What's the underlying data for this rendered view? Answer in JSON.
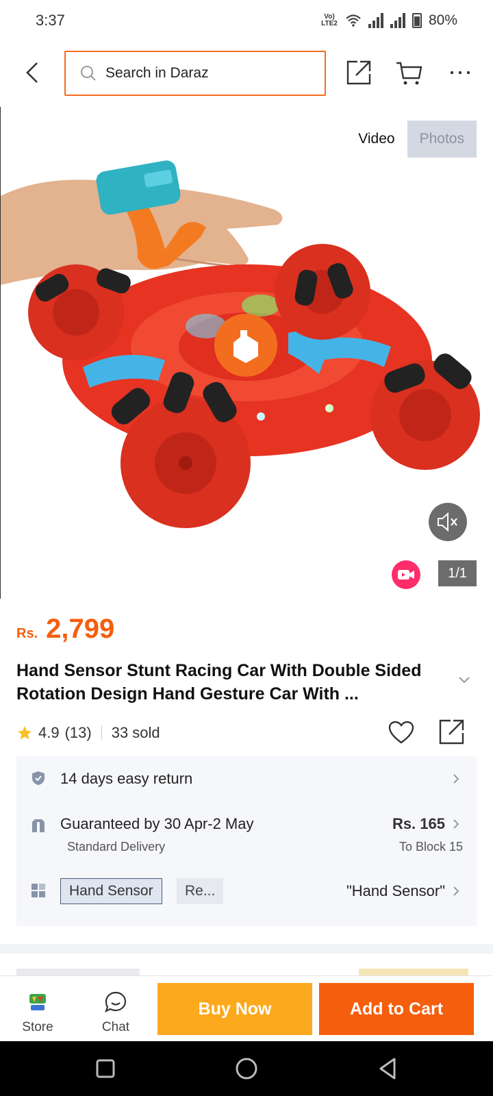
{
  "status_bar": {
    "time": "3:37",
    "network": "Vo) LTE2",
    "battery": "80%"
  },
  "header": {
    "search_placeholder": "Search in Daraz"
  },
  "gallery": {
    "tabs": [
      {
        "label": "Video",
        "selected": false
      },
      {
        "label": "Photos",
        "selected": true
      }
    ],
    "counter": "1/1"
  },
  "product": {
    "currency": "Rs.",
    "price": "2,799",
    "title": "Hand Sensor Stunt Racing Car With Double Sided Rotation Design Hand Gesture Car With ...",
    "rating": "4.9",
    "reviews": "(13)",
    "sold": "33 sold"
  },
  "info": {
    "return_text": "14 days easy return",
    "delivery_text": "Guaranteed by 30 Apr-2 May",
    "delivery_type": "Standard Delivery",
    "delivery_fee": "Rs. 165",
    "delivery_location": "To Block 15",
    "variants": [
      "Hand Sensor",
      "Re..."
    ],
    "selected_variant": "\"Hand Sensor\""
  },
  "bottom_bar": {
    "store_label": "Store",
    "chat_label": "Chat",
    "buy_now": "Buy Now",
    "add_to_cart": "Add to Cart"
  },
  "colors": {
    "accent_orange": "#f55e0d",
    "buy_now_yellow": "#fda91d",
    "search_border": "#f36d1f"
  }
}
